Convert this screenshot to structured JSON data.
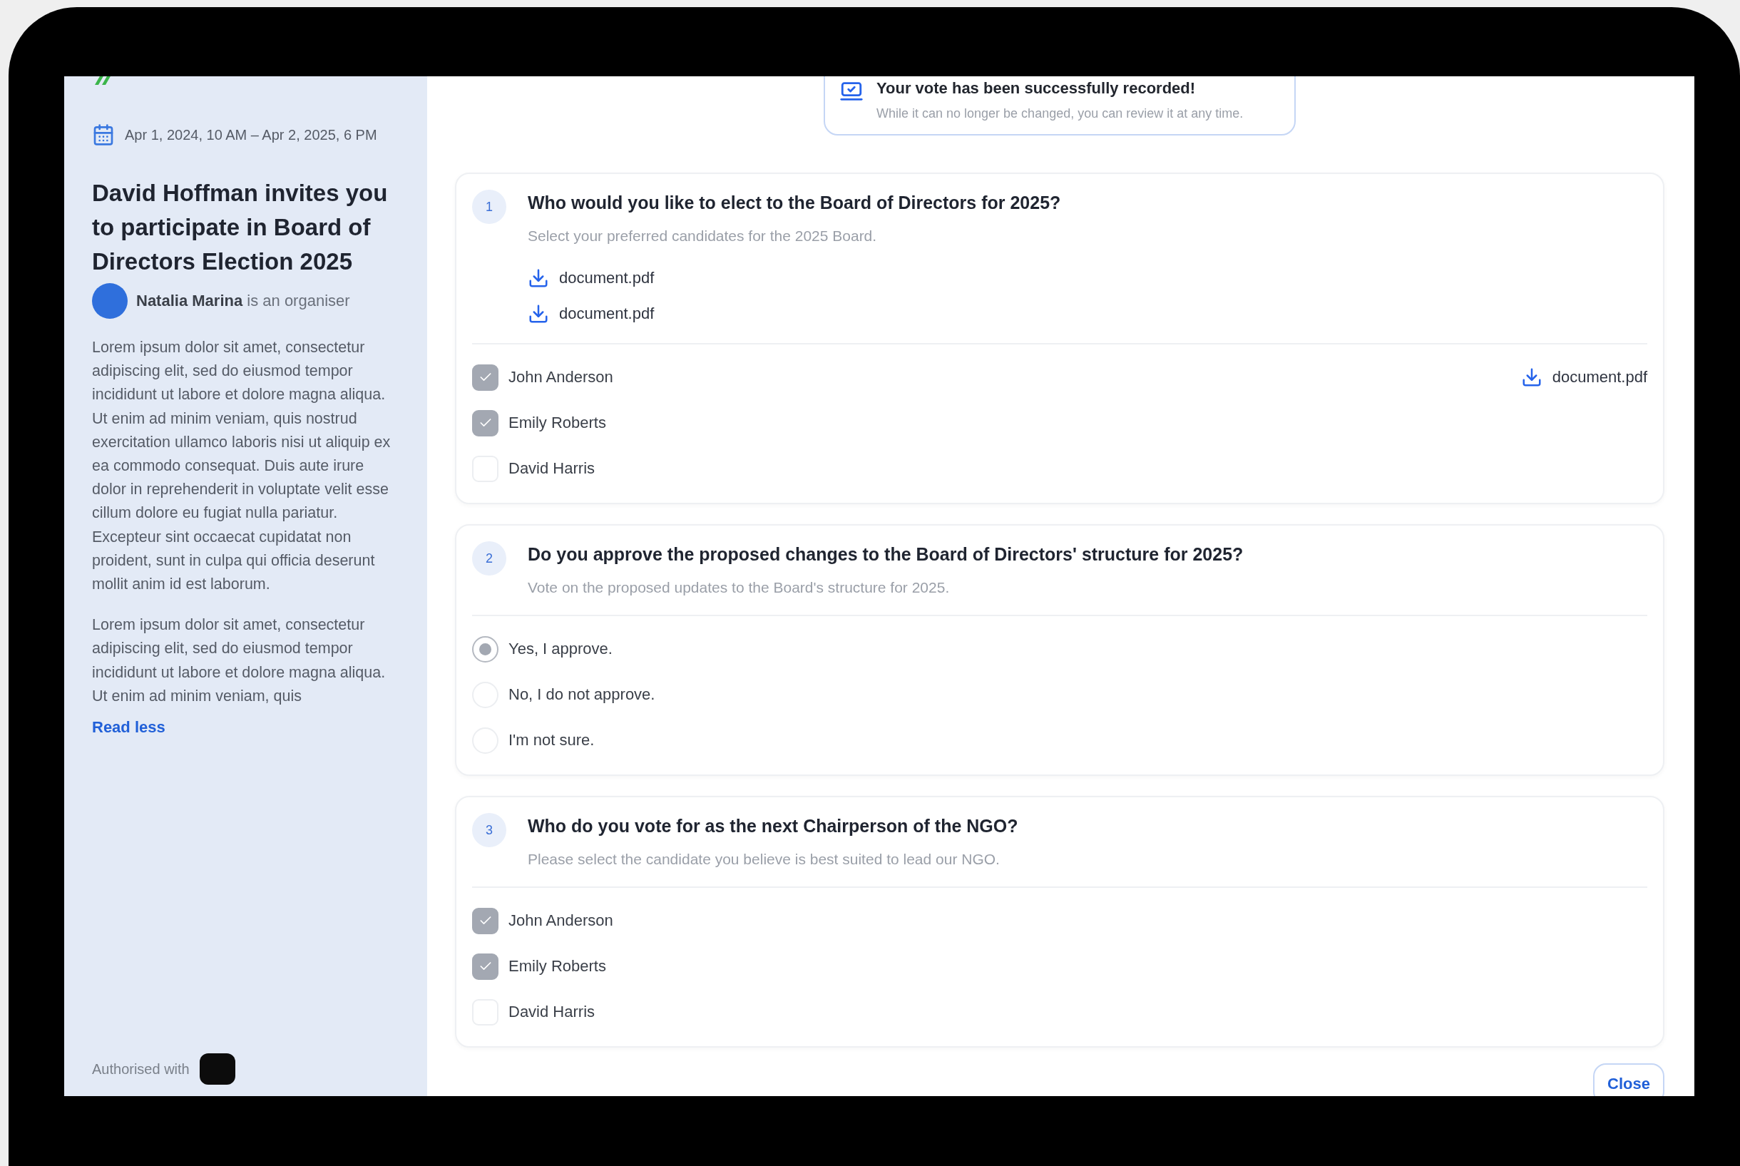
{
  "sidebar": {
    "date_range": "Apr 1, 2024, 10 AM – Apr 2, 2025, 6 PM",
    "title": "David Hoffman invites you to participate in Board of Directors Election 2025",
    "organiser": {
      "name": "Natalia Marina",
      "role_text": "is an organiser"
    },
    "description": [
      "Lorem ipsum dolor sit amet, consectetur adipiscing elit, sed do eiusmod tempor incididunt ut labore et dolore magna aliqua. Ut enim ad minim veniam, quis nostrud exercitation ullamco laboris nisi ut aliquip ex ea commodo consequat. Duis aute irure dolor in reprehenderit in voluptate velit esse cillum dolore eu fugiat nulla pariatur. Excepteur sint occaecat cupidatat non proident, sunt in culpa qui officia deserunt mollit anim id est laborum.",
      "Lorem ipsum dolor sit amet, consectetur adipiscing elit, sed do eiusmod tempor incididunt ut labore et dolore magna aliqua. Ut enim ad minim veniam, quis"
    ],
    "read_less": "Read less",
    "footer": "Authorised with"
  },
  "banner": {
    "title": "Your vote has been successfully recorded!",
    "message": "While it can no longer be changed, you can review it at any time."
  },
  "questions": [
    {
      "number": "1",
      "title": "Who would you like to elect to the Board of Directors for 2025?",
      "subtitle": "Select your preferred candidates for the 2025 Board.",
      "documents": [
        "document.pdf",
        "document.pdf"
      ],
      "kind": "checkbox",
      "options": [
        {
          "label": "John Anderson",
          "checked": true,
          "document": "document.pdf"
        },
        {
          "label": "Emily Roberts",
          "checked": true
        },
        {
          "label": "David Harris",
          "checked": false
        }
      ]
    },
    {
      "number": "2",
      "title": "Do you approve the proposed changes to the Board of Directors' structure for 2025?",
      "subtitle": "Vote on the proposed updates to the Board's structure for 2025.",
      "kind": "radio",
      "options": [
        {
          "label": "Yes, I approve.",
          "selected": true
        },
        {
          "label": "No, I do not approve.",
          "selected": false
        },
        {
          "label": "I'm not sure.",
          "selected": false
        }
      ]
    },
    {
      "number": "3",
      "title": "Who do you vote for as the next Chairperson of the NGO?",
      "subtitle": "Please select the candidate you believe is best suited to lead our NGO.",
      "kind": "checkbox",
      "options": [
        {
          "label": "John Anderson",
          "checked": true
        },
        {
          "label": "Emily Roberts",
          "checked": true
        },
        {
          "label": "David Harris",
          "checked": false
        }
      ]
    }
  ],
  "close_button": "Close"
}
